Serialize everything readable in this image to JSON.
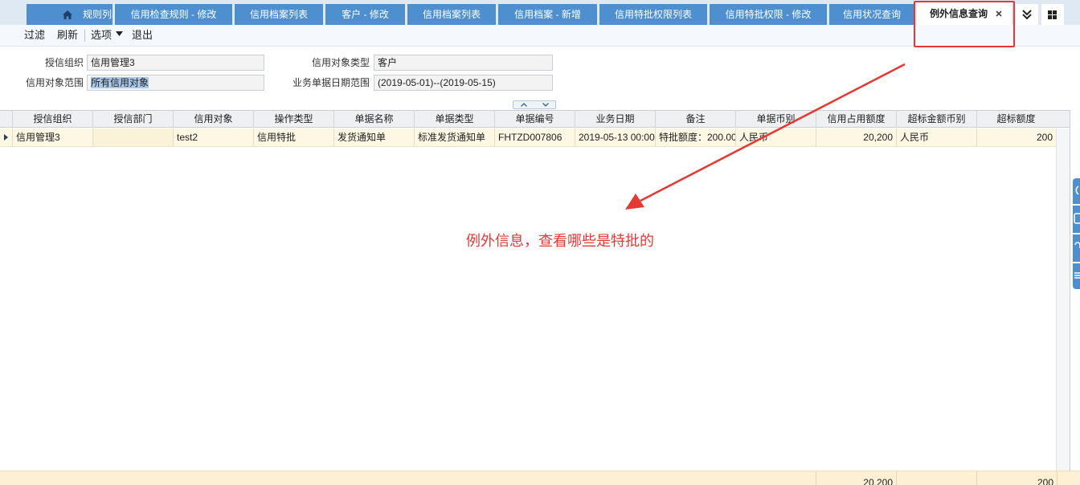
{
  "tabs": [
    {
      "label": "规则列表"
    },
    {
      "label": "信用检查规则 - 修改"
    },
    {
      "label": "信用档案列表"
    },
    {
      "label": "客户 - 修改"
    },
    {
      "label": "信用档案列表"
    },
    {
      "label": "信用档案 - 新增"
    },
    {
      "label": "信用特批权限列表"
    },
    {
      "label": "信用特批权限 - 修改"
    },
    {
      "label": "信用状况查询"
    }
  ],
  "active_tab": {
    "label": "例外信息查询",
    "close": "×"
  },
  "toolbar": {
    "filter": "过滤",
    "refresh": "刷新",
    "options": "选项",
    "exit": "退出"
  },
  "filters": {
    "credit_org_label": "授信组织",
    "credit_org_value": "信用管理3",
    "object_type_label": "信用对象类型",
    "object_type_value": "客户",
    "object_scope_label": "信用对象范围",
    "object_scope_value": "所有信用对象",
    "date_range_label": "业务单据日期范围",
    "date_range_value": "(2019-05-01)--(2019-05-15)"
  },
  "grid": {
    "headers": [
      "授信组织",
      "授信部门",
      "信用对象",
      "操作类型",
      "单据名称",
      "单据类型",
      "单据编号",
      "业务日期",
      "备注",
      "单据币别",
      "信用占用额度",
      "超标金额币别",
      "超标额度"
    ],
    "row": [
      "信用管理3",
      "",
      "test2",
      "信用特批",
      "发货通知单",
      "标准发货通知单",
      "FHTZD007806",
      "2019-05-13 00:00",
      "特批额度：200.00",
      "人民币",
      "20,200",
      "人民币",
      "200"
    ],
    "totals": {
      "credit_used": "20,200",
      "excess_amount": "200"
    }
  },
  "annotation": "例外信息，查看哪些是特批的",
  "colors": {
    "tab_blue": "#4e8fd0",
    "annotation_red": "#e53935",
    "row_highlight": "#fdf7e3"
  }
}
